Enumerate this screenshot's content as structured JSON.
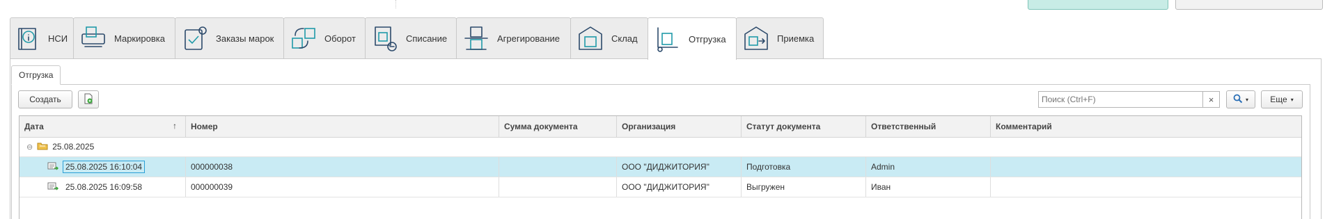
{
  "tabs": [
    {
      "label": "НСИ",
      "icon": "book-info-icon"
    },
    {
      "label": "Маркировка",
      "icon": "label-printer-icon"
    },
    {
      "label": "Заказы марок",
      "icon": "order-checklist-icon"
    },
    {
      "label": "Оборот",
      "icon": "turnover-arrows-icon"
    },
    {
      "label": "Списание",
      "icon": "writeoff-box-icon"
    },
    {
      "label": "Агрегирование",
      "icon": "aggregation-boxes-icon"
    },
    {
      "label": "Склад",
      "icon": "warehouse-icon"
    },
    {
      "label": "Отгрузка",
      "icon": "shipment-cart-icon",
      "active": true
    },
    {
      "label": "Приемка",
      "icon": "receiving-warehouse-icon"
    }
  ],
  "subtab": {
    "label": "Отгрузка"
  },
  "toolbar": {
    "create_label": "Создать",
    "search_placeholder": "Поиск (Ctrl+F)",
    "clear_symbol": "×",
    "more_label": "Еще"
  },
  "table": {
    "columns": {
      "date": "Дата",
      "number": "Номер",
      "sum": "Сумма документа",
      "org": "Организация",
      "status": "Статут документа",
      "responsible": "Ответственный",
      "comment": "Комментарий"
    },
    "sort_indicator": "↑",
    "group": {
      "collapse_symbol": "⊖",
      "label": "25.08.2025"
    },
    "rows": [
      {
        "date": "25.08.2025 16:10:04",
        "number": "000000038",
        "sum": "",
        "org": "ООО \"ДИДЖИТОРИЯ\"",
        "status": "Подготовка",
        "responsible": "Admin",
        "comment": ""
      },
      {
        "date": "25.08.2025 16:09:58",
        "number": "000000039",
        "sum": "",
        "org": "ООО \"ДИДЖИТОРИЯ\"",
        "status": "Выгружен",
        "responsible": "Иван",
        "comment": ""
      }
    ]
  },
  "colors": {
    "accent": "#1f9aa8",
    "icon_dark": "#2c4a6b",
    "selected_row": "#c9ebf4",
    "focus_border": "#2a9fd6"
  }
}
